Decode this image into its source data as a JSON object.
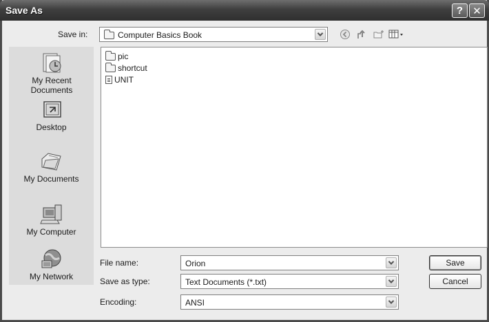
{
  "window": {
    "title": "Save As"
  },
  "titlebar": {
    "help_label": "?",
    "close_label": "✕"
  },
  "toolbar": {
    "save_in_label": "Save in:",
    "save_in_value": "Computer Basics Book",
    "icons": [
      "back-icon",
      "up-folder-icon",
      "new-folder-icon",
      "views-menu-icon"
    ]
  },
  "places": [
    {
      "label": "My Recent Documents",
      "icon": "recent-documents-icon"
    },
    {
      "label": "Desktop",
      "icon": "desktop-icon"
    },
    {
      "label": "My Documents",
      "icon": "my-documents-icon"
    },
    {
      "label": "My Computer",
      "icon": "my-computer-icon"
    },
    {
      "label": "My Network",
      "icon": "my-network-icon"
    }
  ],
  "files": [
    {
      "name": "pic",
      "type": "folder"
    },
    {
      "name": "shortcut",
      "type": "folder"
    },
    {
      "name": "UNIT",
      "type": "file"
    }
  ],
  "form": {
    "file_name_label": "File name:",
    "file_name_value": "Orion",
    "save_type_label": "Save as type:",
    "save_type_value": "Text Documents (*.txt)",
    "encoding_label": "Encoding:",
    "encoding_value": "ANSI"
  },
  "buttons": {
    "save": "Save",
    "cancel": "Cancel"
  }
}
